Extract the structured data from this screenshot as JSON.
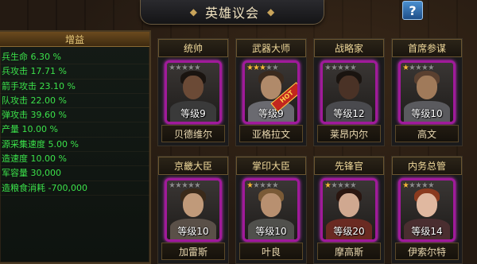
{
  "title": "英雄议会",
  "help_label": "?",
  "bonus_panel": {
    "header": "增益",
    "stats": [
      "兵生命 6.30 %",
      "兵攻击 17.71 %",
      "箭手攻击 23.10 %",
      "队攻击 22.00 %",
      "弹攻击 39.60 %",
      "产量 10.00 %",
      "源采集速度 5.00 %",
      "造速度 10.00 %",
      "军容量 30,000",
      "造粮食消耗 -700,000"
    ]
  },
  "heroes": [
    {
      "role": "统帅",
      "level": "等级9",
      "name": "贝德维尔",
      "stars": 0,
      "hot": false,
      "skin": "#6b4a36",
      "hair": "#1a1410",
      "cloth": "#3a3a3a"
    },
    {
      "role": "武器大师",
      "level": "等级9",
      "name": "亚格拉文",
      "stars": 3,
      "hot": true,
      "hot_label": "HOT",
      "skin": "#b08a6a",
      "hair": "#3a2a1e",
      "cloth": "#6a6a70"
    },
    {
      "role": "战略家",
      "level": "等级12",
      "name": "莱昂内尔",
      "stars": 0,
      "hot": false,
      "skin": "#4a3226",
      "hair": "#1a1410",
      "cloth": "#4a4a4e"
    },
    {
      "role": "首席参谋",
      "level": "等级10",
      "name": "高文",
      "stars": 1,
      "hot": false,
      "skin": "#a07a5a",
      "hair": "#5a4030",
      "cloth": "#5a5a5e"
    },
    {
      "role": "京畿大臣",
      "level": "等级10",
      "name": "加雷斯",
      "stars": 0,
      "hot": false,
      "skin": "#c09a7a",
      "hair": "#3a2a1a",
      "cloth": "#5a5048"
    },
    {
      "role": "掌印大臣",
      "level": "等级10",
      "name": "叶良",
      "stars": 1,
      "hot": false,
      "skin": "#b89070",
      "hair": "#7a5a36",
      "cloth": "#50504c"
    },
    {
      "role": "先锋官",
      "level": "等级20",
      "name": "摩高斯",
      "stars": 1,
      "hot": false,
      "skin": "#d0a890",
      "hair": "#2a1610",
      "cloth": "#6a2a22"
    },
    {
      "role": "内务总管",
      "level": "等级14",
      "name": "伊索尔特",
      "stars": 1,
      "hot": false,
      "skin": "#e0b8a0",
      "hair": "#8a3a1e",
      "cloth": "#4a2e30"
    }
  ]
}
